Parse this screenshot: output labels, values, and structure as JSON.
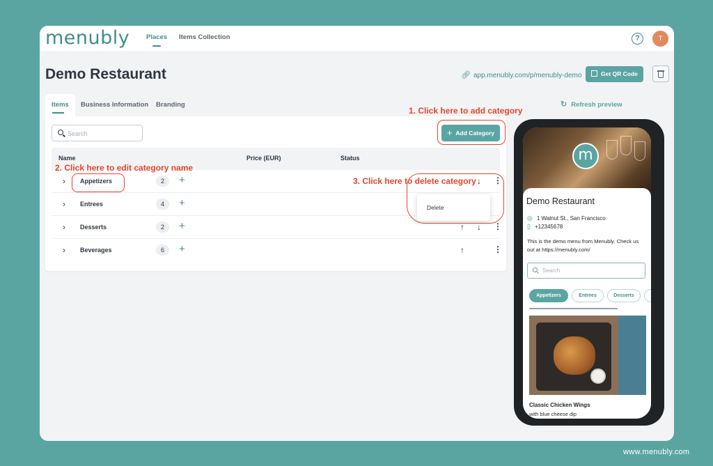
{
  "app": {
    "logo": "menubly",
    "nav": [
      "Places",
      "Items Collection"
    ],
    "help_icon": "?",
    "avatar_initial": "T"
  },
  "header": {
    "title": "Demo Restaurant",
    "public_link": "app.menubly.com/p/menubly-demo",
    "qr_button": "Get QR Code"
  },
  "tabs": [
    "Items",
    "Business Information",
    "Branding"
  ],
  "toolbar": {
    "search_placeholder": "Search",
    "add_category": "Add Category"
  },
  "table": {
    "columns": [
      "Name",
      "Price (EUR)",
      "Status"
    ],
    "rows": [
      {
        "name": "Appetizers",
        "count": "2"
      },
      {
        "name": "Entrees",
        "count": "4"
      },
      {
        "name": "Desserts",
        "count": "2"
      },
      {
        "name": "Beverages",
        "count": "6"
      }
    ]
  },
  "dropdown": {
    "delete": "Delete"
  },
  "annotations": {
    "add": "1. Click here to add category",
    "edit": "2. Click here to edit category name",
    "delete": "3. Click here to delete category"
  },
  "preview": {
    "refresh": "Refresh preview",
    "logo_letter": "m",
    "restaurant_name": "Demo Restaurant",
    "address": "1 Walnut St., San Francisco",
    "phone": "+12345678",
    "description": "This is the demo menu from Menubly. Check us out at https://menubly.com/",
    "search_placeholder": "Search",
    "chips": [
      "Appetizers",
      "Entrees",
      "Desserts"
    ],
    "dish_title": "Classic Chicken Wings",
    "dish_subtitle": "with blue cheese dip"
  },
  "footer": "www.menubly.com",
  "colors": {
    "background": "#5aa5a1",
    "brand": "#3f8f8b",
    "annotation": "#e5452c"
  }
}
